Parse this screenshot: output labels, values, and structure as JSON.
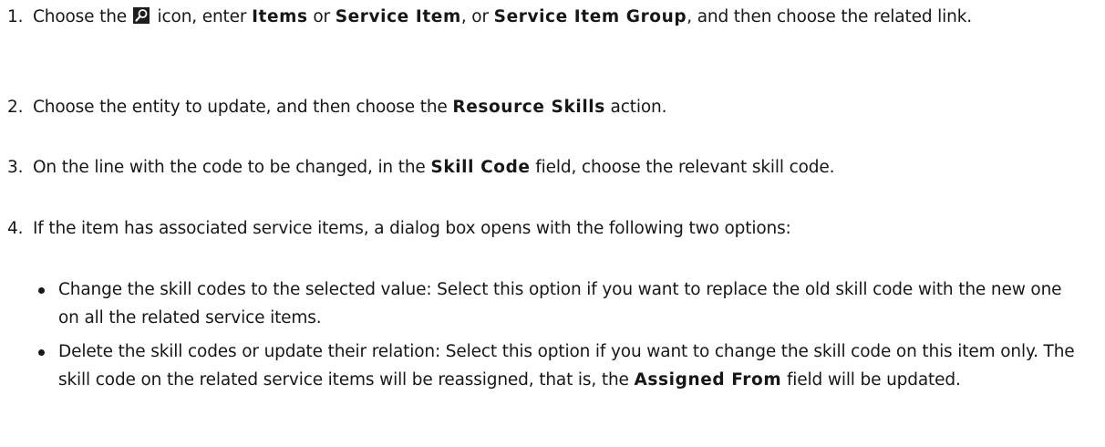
{
  "steps": [
    {
      "number": "1.",
      "before_icon": "Choose the ",
      "icon": "search-icon",
      "after_icon": " icon, enter ",
      "term1": "Items",
      "or1": " or ",
      "term2": "Service Item",
      "or2": ", or ",
      "term3": "Service Item Group",
      "tail": ", and then choose the related link."
    },
    {
      "number": "2.",
      "before": "Choose the entity to update, and then choose the ",
      "term": "Resource Skills",
      "after": " action."
    },
    {
      "number": "3.",
      "before": "On the line with the code to be changed, in the ",
      "term": "Skill Code",
      "after": " field, choose the relevant skill code."
    },
    {
      "number": "4.",
      "text": "If the item has associated service items, a dialog box opens with the following two options:"
    }
  ],
  "options": [
    {
      "text": "Change the skill codes to the selected value: Select this option if you want to replace the old skill code with the new one on all the related service items."
    },
    {
      "before": "Delete the skill codes or update their relation: Select this option if you want to change the skill code on this item only. The skill code on the related service items will be reassigned, that is, the ",
      "term": "Assigned From",
      "after": " field will be updated."
    }
  ]
}
